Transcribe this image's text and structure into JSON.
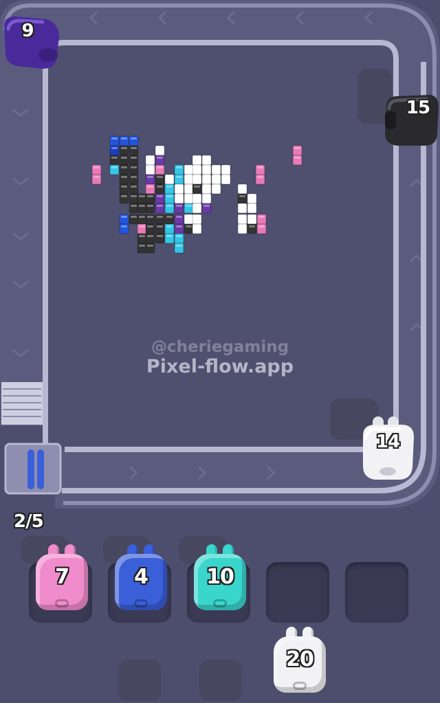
{
  "board": {
    "pixels": [
      [
        160,
        198,
        "#2255dd"
      ],
      [
        174,
        198,
        "#2255dd"
      ],
      [
        188,
        198,
        "#2255dd"
      ],
      [
        160,
        212,
        "#1a3fbf"
      ],
      [
        174,
        212,
        "#333333"
      ],
      [
        188,
        212,
        "#333333"
      ],
      [
        226,
        212,
        "#ffffff"
      ],
      [
        160,
        226,
        "#333333"
      ],
      [
        174,
        226,
        "#333333"
      ],
      [
        188,
        226,
        "#333333"
      ],
      [
        212,
        226,
        "#ffffff"
      ],
      [
        226,
        226,
        "#6a3aa6"
      ],
      [
        280,
        226,
        "#ffffff"
      ],
      [
        294,
        226,
        "#ffffff"
      ],
      [
        134,
        240,
        "#e87ab8"
      ],
      [
        160,
        240,
        "#33c6e6"
      ],
      [
        174,
        240,
        "#333333"
      ],
      [
        188,
        240,
        "#333333"
      ],
      [
        212,
        240,
        "#ffffff"
      ],
      [
        226,
        240,
        "#e87ab8"
      ],
      [
        254,
        240,
        "#33c6e6"
      ],
      [
        268,
        240,
        "#ffffff"
      ],
      [
        280,
        240,
        "#ffffff"
      ],
      [
        294,
        240,
        "#ffffff"
      ],
      [
        308,
        240,
        "#ffffff"
      ],
      [
        322,
        240,
        "#ffffff"
      ],
      [
        372,
        240,
        "#e87ab8"
      ],
      [
        174,
        254,
        "#333333"
      ],
      [
        188,
        254,
        "#333333"
      ],
      [
        212,
        254,
        "#6a3aa6"
      ],
      [
        226,
        254,
        "#333333"
      ],
      [
        240,
        254,
        "#ffffff"
      ],
      [
        254,
        254,
        "#33c6e6"
      ],
      [
        268,
        254,
        "#ffffff"
      ],
      [
        280,
        254,
        "#ffffff"
      ],
      [
        294,
        254,
        "#ffffff"
      ],
      [
        308,
        254,
        "#ffffff"
      ],
      [
        322,
        254,
        "#ffffff"
      ],
      [
        174,
        268,
        "#333333"
      ],
      [
        188,
        268,
        "#333333"
      ],
      [
        212,
        268,
        "#e87ab8"
      ],
      [
        226,
        268,
        "#333333"
      ],
      [
        240,
        268,
        "#33c6e6"
      ],
      [
        254,
        268,
        "#ffffff"
      ],
      [
        268,
        268,
        "#ffffff"
      ],
      [
        280,
        268,
        "#333333"
      ],
      [
        294,
        268,
        "#ffffff"
      ],
      [
        308,
        268,
        "#ffffff"
      ],
      [
        346,
        268,
        "#ffffff"
      ],
      [
        174,
        282,
        "#333333"
      ],
      [
        188,
        282,
        "#333333"
      ],
      [
        200,
        282,
        "#333333"
      ],
      [
        212,
        282,
        "#333333"
      ],
      [
        226,
        282,
        "#6a3aa6"
      ],
      [
        240,
        282,
        "#33c6e6"
      ],
      [
        254,
        282,
        "#ffffff"
      ],
      [
        268,
        282,
        "#ffffff"
      ],
      [
        280,
        282,
        "#ffffff"
      ],
      [
        294,
        282,
        "#ffffff"
      ],
      [
        346,
        282,
        "#333333"
      ],
      [
        360,
        282,
        "#ffffff"
      ],
      [
        188,
        296,
        "#333333"
      ],
      [
        200,
        296,
        "#333333"
      ],
      [
        212,
        296,
        "#333333"
      ],
      [
        226,
        296,
        "#6a3aa6"
      ],
      [
        240,
        296,
        "#33c6e6"
      ],
      [
        254,
        296,
        "#6a3aa6"
      ],
      [
        268,
        296,
        "#33c6e6"
      ],
      [
        280,
        296,
        "#ffffff"
      ],
      [
        294,
        296,
        "#6a3aa6"
      ],
      [
        346,
        296,
        "#ffffff"
      ],
      [
        360,
        296,
        "#ffffff"
      ],
      [
        174,
        312,
        "#2255dd"
      ],
      [
        188,
        312,
        "#333333"
      ],
      [
        200,
        312,
        "#333333"
      ],
      [
        212,
        312,
        "#333333"
      ],
      [
        226,
        312,
        "#333333"
      ],
      [
        240,
        312,
        "#333333"
      ],
      [
        254,
        312,
        "#6a3aa6"
      ],
      [
        268,
        312,
        "#ffffff"
      ],
      [
        280,
        312,
        "#ffffff"
      ],
      [
        346,
        312,
        "#ffffff"
      ],
      [
        360,
        312,
        "#ffffff"
      ],
      [
        374,
        312,
        "#e87ab8"
      ],
      [
        174,
        326,
        "#2255dd"
      ],
      [
        200,
        326,
        "#e87ab8"
      ],
      [
        212,
        326,
        "#333333"
      ],
      [
        226,
        326,
        "#333333"
      ],
      [
        240,
        326,
        "#33c6e6"
      ],
      [
        254,
        326,
        "#6a3aa6"
      ],
      [
        268,
        326,
        "#333333"
      ],
      [
        280,
        326,
        "#ffffff"
      ],
      [
        346,
        326,
        "#ffffff"
      ],
      [
        360,
        326,
        "#333333"
      ],
      [
        374,
        326,
        "#e87ab8"
      ],
      [
        200,
        340,
        "#333333"
      ],
      [
        212,
        340,
        "#333333"
      ],
      [
        226,
        340,
        "#333333"
      ],
      [
        240,
        340,
        "#33c6e6"
      ],
      [
        254,
        340,
        "#33c6e6"
      ],
      [
        200,
        354,
        "#333333"
      ],
      [
        212,
        354,
        "#333333"
      ],
      [
        254,
        354,
        "#33c6e6"
      ],
      [
        426,
        212,
        "#e87ab8"
      ],
      [
        426,
        226,
        "#e87ab8"
      ],
      [
        372,
        254,
        "#e87ab8"
      ],
      [
        134,
        254,
        "#e87ab8"
      ]
    ]
  },
  "watermark": {
    "handle": "@cheriegaming",
    "site": "Pixel-flow.app"
  },
  "belt_shooters": [
    {
      "label": "9",
      "color": "#4a2a9a"
    },
    {
      "label": "15",
      "color": "#2a2a2e"
    },
    {
      "label": "14",
      "color": "#f2f2f4"
    }
  ],
  "queue": {
    "counter": "2/5"
  },
  "slots": [
    {
      "label": "7",
      "color": "#f08ccc",
      "state": "filled"
    },
    {
      "label": "4",
      "color": "#3a5fd8",
      "state": "filled"
    },
    {
      "label": "10",
      "color": "#3ad6cc",
      "state": "filled"
    },
    {
      "label": "",
      "color": "",
      "state": "empty"
    },
    {
      "label": "",
      "color": "",
      "state": "empty"
    }
  ],
  "next_pig": {
    "label": "20",
    "color": "#f2f2f4"
  },
  "icons": [
    "conveyor-belt-icon",
    "stack-icon",
    "pig-shooter-icon"
  ]
}
